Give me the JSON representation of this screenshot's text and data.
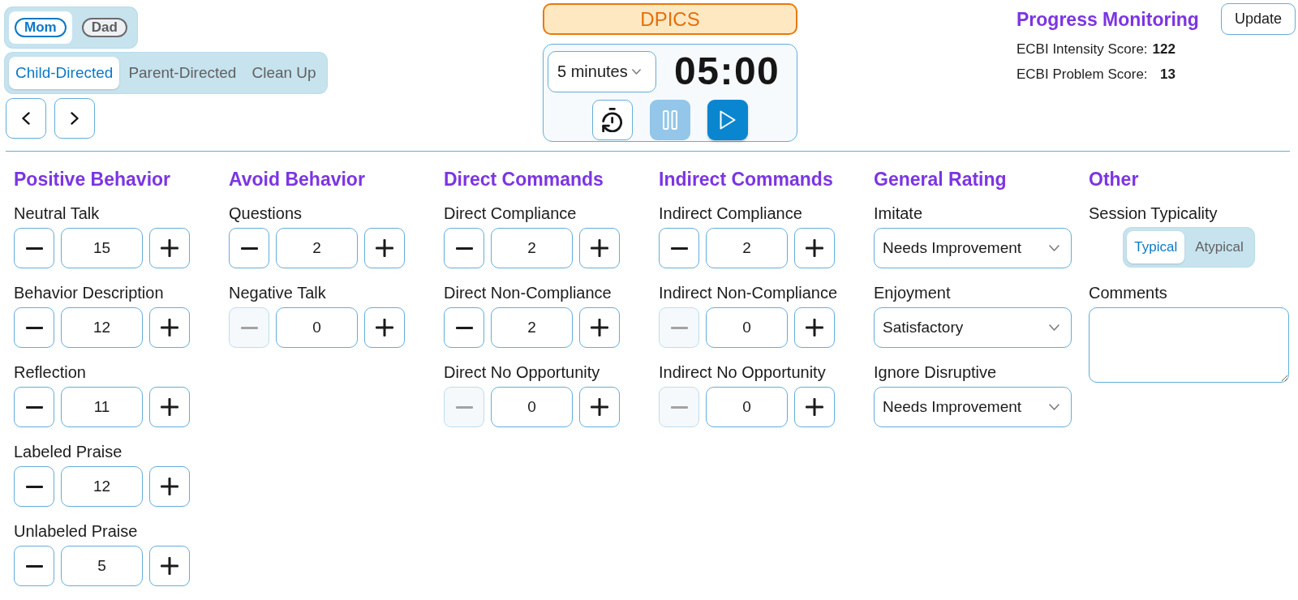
{
  "parent_toggle": [
    {
      "label": "Mom",
      "selected": true
    },
    {
      "label": "Dad",
      "selected": false
    }
  ],
  "mode_tabs": [
    {
      "label": "Child-Directed",
      "selected": true
    },
    {
      "label": "Parent-Directed",
      "selected": false
    },
    {
      "label": "Clean Up",
      "selected": false
    }
  ],
  "title_banner": "DPICS",
  "timer": {
    "duration": "5 minutes",
    "display": "05:00",
    "controls": [
      {
        "kind": "reset",
        "disabled": false
      },
      {
        "kind": "pause",
        "disabled": true
      },
      {
        "kind": "play",
        "disabled": false
      }
    ]
  },
  "progress_monitoring": {
    "title": "Progress Monitoring",
    "button": "Update",
    "scores": [
      {
        "label": "ECBI Intensity Score:",
        "value": "122"
      },
      {
        "label": "ECBI Problem Score:",
        "value": "13"
      }
    ]
  },
  "sections": [
    {
      "title": "Positive Behavior",
      "items": [
        {
          "kind": "counter",
          "label": "Neutral Talk",
          "value": "15",
          "minus_disabled": false
        },
        {
          "kind": "counter",
          "label": "Behavior Description",
          "value": "12",
          "minus_disabled": false
        },
        {
          "kind": "counter",
          "label": "Reflection",
          "value": "11",
          "minus_disabled": false
        },
        {
          "kind": "counter",
          "label": "Labeled Praise",
          "value": "12",
          "minus_disabled": false
        },
        {
          "kind": "counter",
          "label": "Unlabeled Praise",
          "value": "5",
          "minus_disabled": false
        }
      ]
    },
    {
      "title": "Avoid Behavior",
      "items": [
        {
          "kind": "counter",
          "label": "Questions",
          "value": "2",
          "minus_disabled": false
        },
        {
          "kind": "counter",
          "label": "Negative Talk",
          "value": "0",
          "minus_disabled": true
        }
      ]
    },
    {
      "title": "Direct Commands",
      "items": [
        {
          "kind": "counter",
          "label": "Direct Compliance",
          "value": "2",
          "minus_disabled": false
        },
        {
          "kind": "counter",
          "label": "Direct Non-Compliance",
          "value": "2",
          "minus_disabled": false
        },
        {
          "kind": "counter",
          "label": "Direct No Opportunity",
          "value": "0",
          "minus_disabled": true
        }
      ]
    },
    {
      "title": "Indirect Commands",
      "items": [
        {
          "kind": "counter",
          "label": "Indirect Compliance",
          "value": "2",
          "minus_disabled": false
        },
        {
          "kind": "counter",
          "label": "Indirect Non-Compliance",
          "value": "0",
          "minus_disabled": true
        },
        {
          "kind": "counter",
          "label": "Indirect No Opportunity",
          "value": "0",
          "minus_disabled": true
        }
      ]
    },
    {
      "title": "General Rating",
      "items": [
        {
          "kind": "select",
          "label": "Imitate",
          "value": "Needs Improvement"
        },
        {
          "kind": "select",
          "label": "Enjoyment",
          "value": "Satisfactory"
        },
        {
          "kind": "select",
          "label": "Ignore Disruptive",
          "value": "Needs Improvement"
        }
      ]
    },
    {
      "title": "Other",
      "items": [
        {
          "kind": "toggle",
          "label": "Session Typicality",
          "options": [
            {
              "label": "Typical",
              "selected": true
            },
            {
              "label": "Atypical",
              "selected": false
            }
          ]
        },
        {
          "kind": "textarea",
          "label": "Comments"
        }
      ]
    }
  ]
}
